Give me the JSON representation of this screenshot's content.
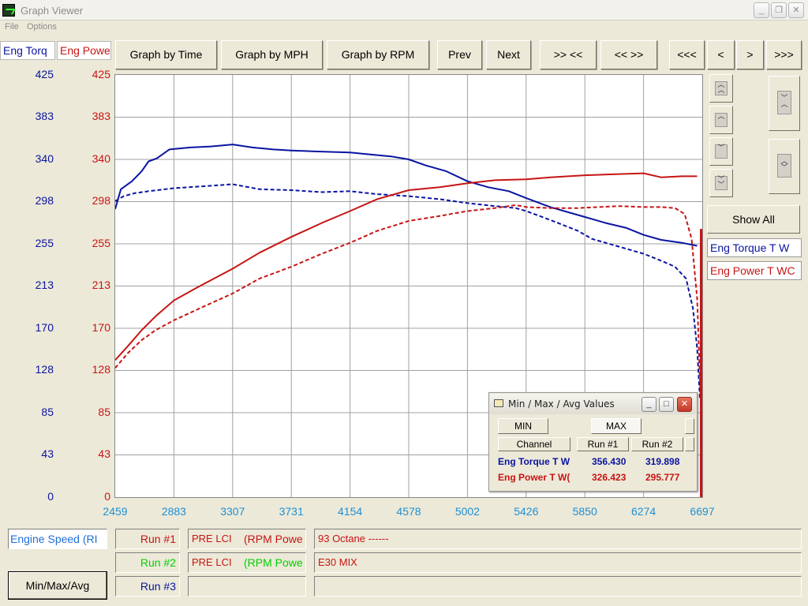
{
  "window": {
    "title": "Graph Viewer"
  },
  "menu": [
    "File",
    "Options"
  ],
  "toolbar": {
    "graph_by_time": "Graph by Time",
    "graph_by_mph": "Graph by MPH",
    "graph_by_rpm": "Graph by RPM",
    "prev": "Prev",
    "next": "Next",
    "zoom_in": ">> <<",
    "zoom_out": "<< >>",
    "first": "<<<",
    "back": "<",
    "forward": ">",
    "last": ">>>"
  },
  "legend_tabs": {
    "torque": "Eng Torq",
    "power": "Eng Powe"
  },
  "right_panel": {
    "show_all": "Show All",
    "channel_1": "Eng Torque T W",
    "channel_2": "Eng Power T WC"
  },
  "colors": {
    "torque": "#0a14a0",
    "power": "#c81414",
    "axis_x": "#1e8fd6",
    "run2": "#00d000"
  },
  "chart_data": {
    "type": "line",
    "x_ticks": [
      "2459",
      "2883",
      "3307",
      "3731",
      "4154",
      "4578",
      "5002",
      "5426",
      "5850",
      "6274",
      "6697"
    ],
    "y_left_ticks": [
      "425",
      "383",
      "340",
      "298",
      "255",
      "213",
      "170",
      "128",
      "85",
      "43",
      "0"
    ],
    "y_right_ticks": [
      "425",
      "383",
      "340",
      "298",
      "255",
      "213",
      "170",
      "128",
      "85",
      "43",
      "0"
    ],
    "xlim": [
      2459,
      6697
    ],
    "ylim": [
      0,
      425
    ],
    "grid": true,
    "series": [
      {
        "name": "Eng Torque T W",
        "run": 1,
        "style": "solid",
        "color": "#0a14a0",
        "x": [
          2459,
          2500,
          2580,
          2650,
          2700,
          2760,
          2850,
          3000,
          3150,
          3307,
          3450,
          3600,
          3731,
          3900,
          4154,
          4300,
          4450,
          4578,
          4700,
          4850,
          5002,
          5150,
          5300,
          5426,
          5600,
          5750,
          5850,
          6000,
          6150,
          6274,
          6400,
          6550,
          6660
        ],
        "y": [
          290,
          310,
          318,
          328,
          338,
          341,
          350,
          352,
          353,
          355,
          352,
          350,
          349,
          348,
          347,
          345,
          343,
          340,
          334,
          328,
          318,
          312,
          308,
          301,
          292,
          286,
          282,
          276,
          271,
          264,
          259,
          256,
          253
        ]
      },
      {
        "name": "Eng Torque T W",
        "run": 2,
        "style": "dashed",
        "color": "#0a14a0",
        "x": [
          2459,
          2520,
          2600,
          2700,
          2883,
          3100,
          3307,
          3500,
          3731,
          3950,
          4154,
          4350,
          4578,
          4800,
          5002,
          5200,
          5350,
          5426,
          5600,
          5800,
          5900,
          6100,
          6274,
          6400,
          6500,
          6580,
          6630,
          6660,
          6680
        ],
        "y": [
          298,
          303,
          306,
          308,
          311,
          313,
          315,
          310,
          309,
          307,
          308,
          305,
          303,
          300,
          296,
          293,
          291,
          288,
          279,
          268,
          260,
          252,
          245,
          238,
          232,
          220,
          190,
          150,
          100
        ]
      },
      {
        "name": "Eng Power T WC",
        "run": 1,
        "style": "solid",
        "color": "#c81414",
        "x": [
          2459,
          2550,
          2650,
          2750,
          2883,
          3050,
          3307,
          3500,
          3731,
          3950,
          4154,
          4350,
          4578,
          4800,
          5002,
          5200,
          5426,
          5600,
          5850,
          6050,
          6274,
          6400,
          6550,
          6660
        ],
        "y": [
          138,
          152,
          168,
          182,
          198,
          211,
          230,
          246,
          262,
          276,
          288,
          300,
          309,
          312,
          316,
          319,
          320,
          322,
          324,
          325,
          326,
          322,
          323,
          323
        ]
      },
      {
        "name": "Eng Power T WC",
        "run": 2,
        "style": "dashed",
        "color": "#c81414",
        "x": [
          2459,
          2550,
          2650,
          2750,
          2883,
          3100,
          3307,
          3500,
          3731,
          3950,
          4154,
          4350,
          4578,
          4800,
          5002,
          5200,
          5350,
          5426,
          5600,
          5800,
          5950,
          6100,
          6274,
          6400,
          6500,
          6570,
          6620,
          6660,
          6685
        ],
        "y": [
          130,
          145,
          158,
          168,
          178,
          192,
          205,
          220,
          232,
          245,
          256,
          268,
          278,
          283,
          288,
          291,
          294,
          292,
          291,
          291,
          292,
          293,
          292,
          292,
          291,
          285,
          260,
          200,
          100
        ]
      }
    ]
  },
  "minmax_dialog": {
    "title": "Min / Max / Avg Values",
    "min_btn": "MIN",
    "max_btn": "MAX",
    "headers": [
      "Channel",
      "Run #1",
      "Run #2"
    ],
    "rows": [
      {
        "channel": "Eng Torque T W",
        "run1": "356.430",
        "run2": "319.898",
        "color": "#0a14a0"
      },
      {
        "channel": "Eng Power T W(",
        "run1": "326.423",
        "run2": "295.777",
        "color": "#c81414"
      }
    ]
  },
  "bottom": {
    "x_channel": "Engine Speed (RI",
    "run1_label": "Run #1",
    "run2_label": "Run #2",
    "run3_label": "Run #3",
    "run1_car": "PRE LCI",
    "run1_mode": "(RPM Powe",
    "run2_car": "PRE LCI",
    "run2_mode": "(RPM Powe",
    "run1_note": "93 Octane ------",
    "run2_note": "E30 MIX",
    "minmax_button": "Min/Max/Avg"
  }
}
